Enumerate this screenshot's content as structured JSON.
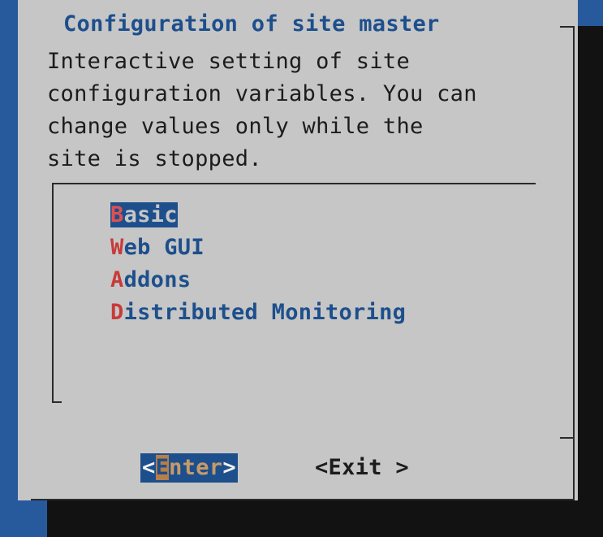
{
  "dialog": {
    "title": "Configuration of site master",
    "description": "Interactive setting of site\nconfiguration variables. You can\nchange values only while the\nsite is stopped."
  },
  "menu": {
    "items": [
      {
        "hotkey": "B",
        "rest": "asic",
        "selected": true
      },
      {
        "hotkey": "W",
        "rest": "eb GUI",
        "selected": false
      },
      {
        "hotkey": "A",
        "rest": "ddons",
        "selected": false
      },
      {
        "hotkey": "D",
        "rest": "istributed Monitoring",
        "selected": false
      }
    ]
  },
  "buttons": {
    "enter": {
      "open": "<",
      "hotkey": "E",
      "rest": "nter",
      "close": ">"
    },
    "exit": {
      "text": "<Exit >"
    }
  },
  "colors": {
    "background": "#275a9c",
    "dialog": "#c6c6c6",
    "accent": "#1d4f8c",
    "hotkey": "#c83a3a",
    "shadow": "#121212"
  }
}
